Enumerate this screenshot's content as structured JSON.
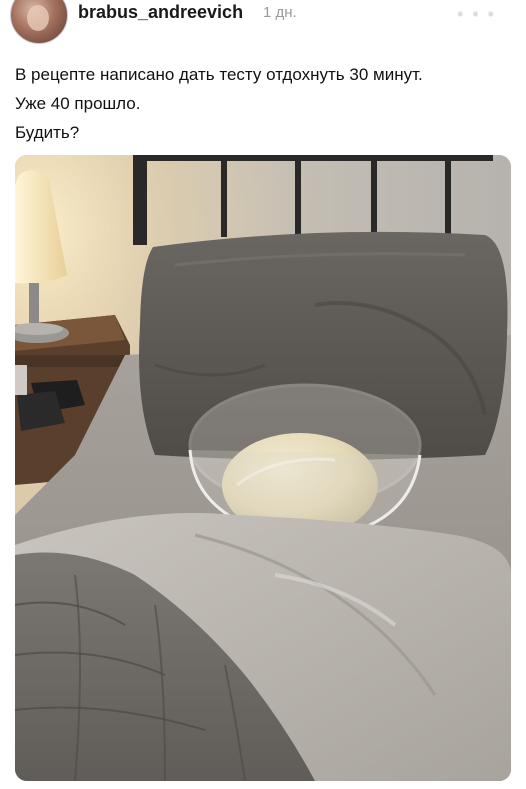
{
  "post": {
    "username": "brabus_andreevich",
    "time": "1 дн.",
    "text_lines": [
      "В рецепте написано дать тесту отдохнуть 30 минут.",
      "Уже 40 прошло.",
      "Будить?"
    ]
  },
  "icons": {
    "avatar": "user-avatar",
    "more": "more-dots-icon"
  }
}
